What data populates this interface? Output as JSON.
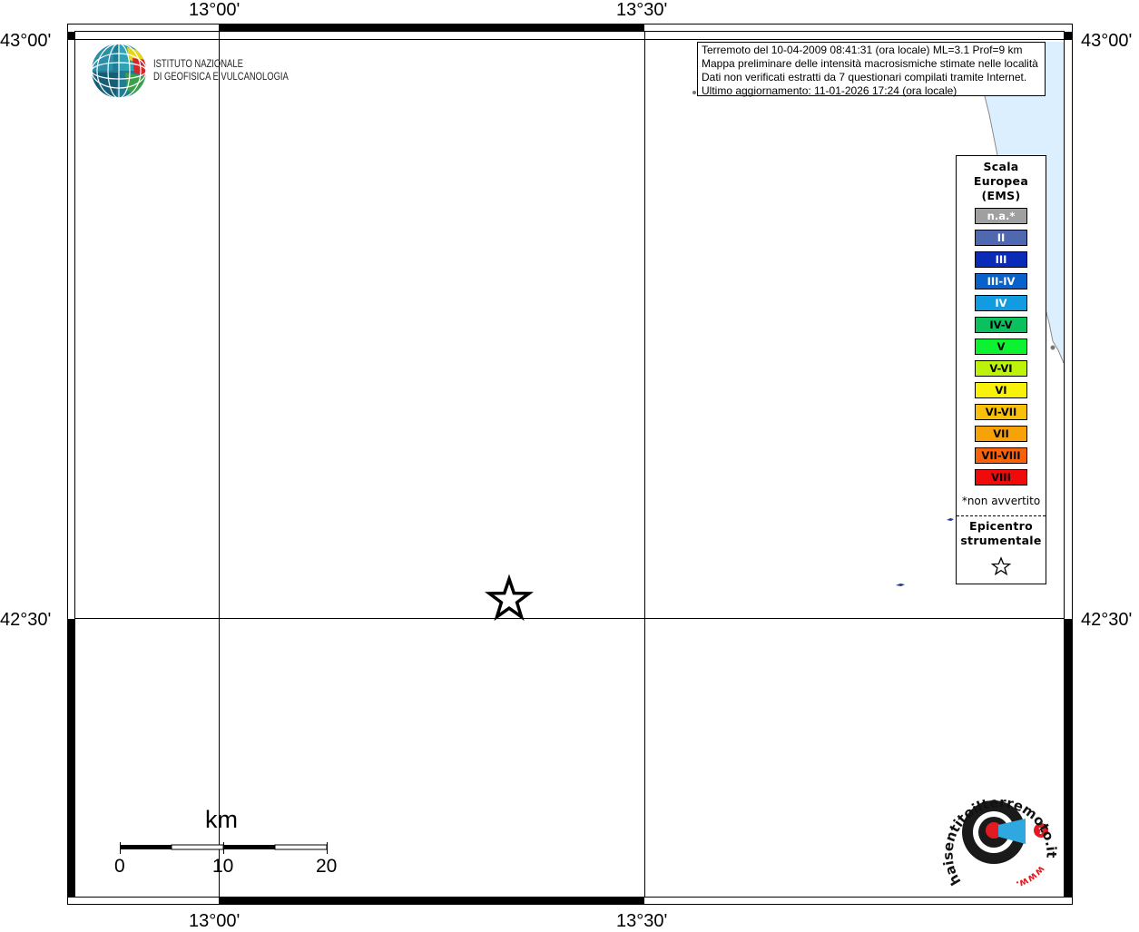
{
  "map": {
    "top_longitude_labels": [
      "13°00'",
      "13°30'"
    ],
    "bottom_longitude_labels": [
      "13°00'",
      "13°30'"
    ],
    "left_latitude_labels": [
      "43°00'",
      "42°30'"
    ],
    "right_latitude_labels": [
      "43°00'",
      "42°30'"
    ],
    "sea_color": "#dcefff",
    "grid_color": "#000000"
  },
  "institution": {
    "name_line1": "ISTITUTO NAZIONALE",
    "name_line2": "DI GEOFISICA E VULCANOLOGIA",
    "logo_icon": "ingv-globe-logo"
  },
  "info": {
    "line1": "Terremoto del 10-04-2009 08:41:31 (ora locale) ML=3.1 Prof=9 km",
    "line2": "Mappa preliminare delle intensità macrosismiche stimate nelle località",
    "line3": "Dati non verificati estratti da 7 questionari compilati tramite Internet.",
    "line4": "Ultimo aggiornamento: 11-01-2026 17:24 (ora locale)"
  },
  "legend": {
    "title_line1": "Scala",
    "title_line2": "Europea",
    "title_line3": "(EMS)",
    "items": [
      {
        "label": "n.a.*",
        "color": "#a0a0a0",
        "text_color": "#ffffff"
      },
      {
        "label": "II",
        "color": "#4f68b0",
        "text_color": "#ffffff"
      },
      {
        "label": "III",
        "color": "#0a2ab8",
        "text_color": "#ffffff"
      },
      {
        "label": "III-IV",
        "color": "#0a62c8",
        "text_color": "#ffffff"
      },
      {
        "label": "IV",
        "color": "#129be0",
        "text_color": "#ffffff"
      },
      {
        "label": "IV-V",
        "color": "#0cc060",
        "text_color": "#000000"
      },
      {
        "label": "V",
        "color": "#0cf230",
        "text_color": "#000000"
      },
      {
        "label": "V-VI",
        "color": "#bdf20a",
        "text_color": "#000000"
      },
      {
        "label": "VI",
        "color": "#f8f20a",
        "text_color": "#000000"
      },
      {
        "label": "VI-VII",
        "color": "#f8c00a",
        "text_color": "#000000"
      },
      {
        "label": "VII",
        "color": "#f8a20a",
        "text_color": "#000000"
      },
      {
        "label": "VII-VIII",
        "color": "#f8620a",
        "text_color": "#000000"
      },
      {
        "label": "VIII",
        "color": "#f20a0a",
        "text_color": "#000000"
      }
    ],
    "note": "*non avvertito",
    "epicenter_line1": "Epicentro",
    "epicenter_line2": "strumentale",
    "epicenter_icon": "star-outline-icon"
  },
  "scale_bar": {
    "title": "km",
    "ticks": [
      "0",
      "10",
      "20"
    ]
  },
  "epicenter": {
    "icon": "star-outline-icon"
  },
  "watermark": {
    "text": "www.haisentitoilterremoto.it",
    "logo_icon": "haisentito-logo"
  }
}
